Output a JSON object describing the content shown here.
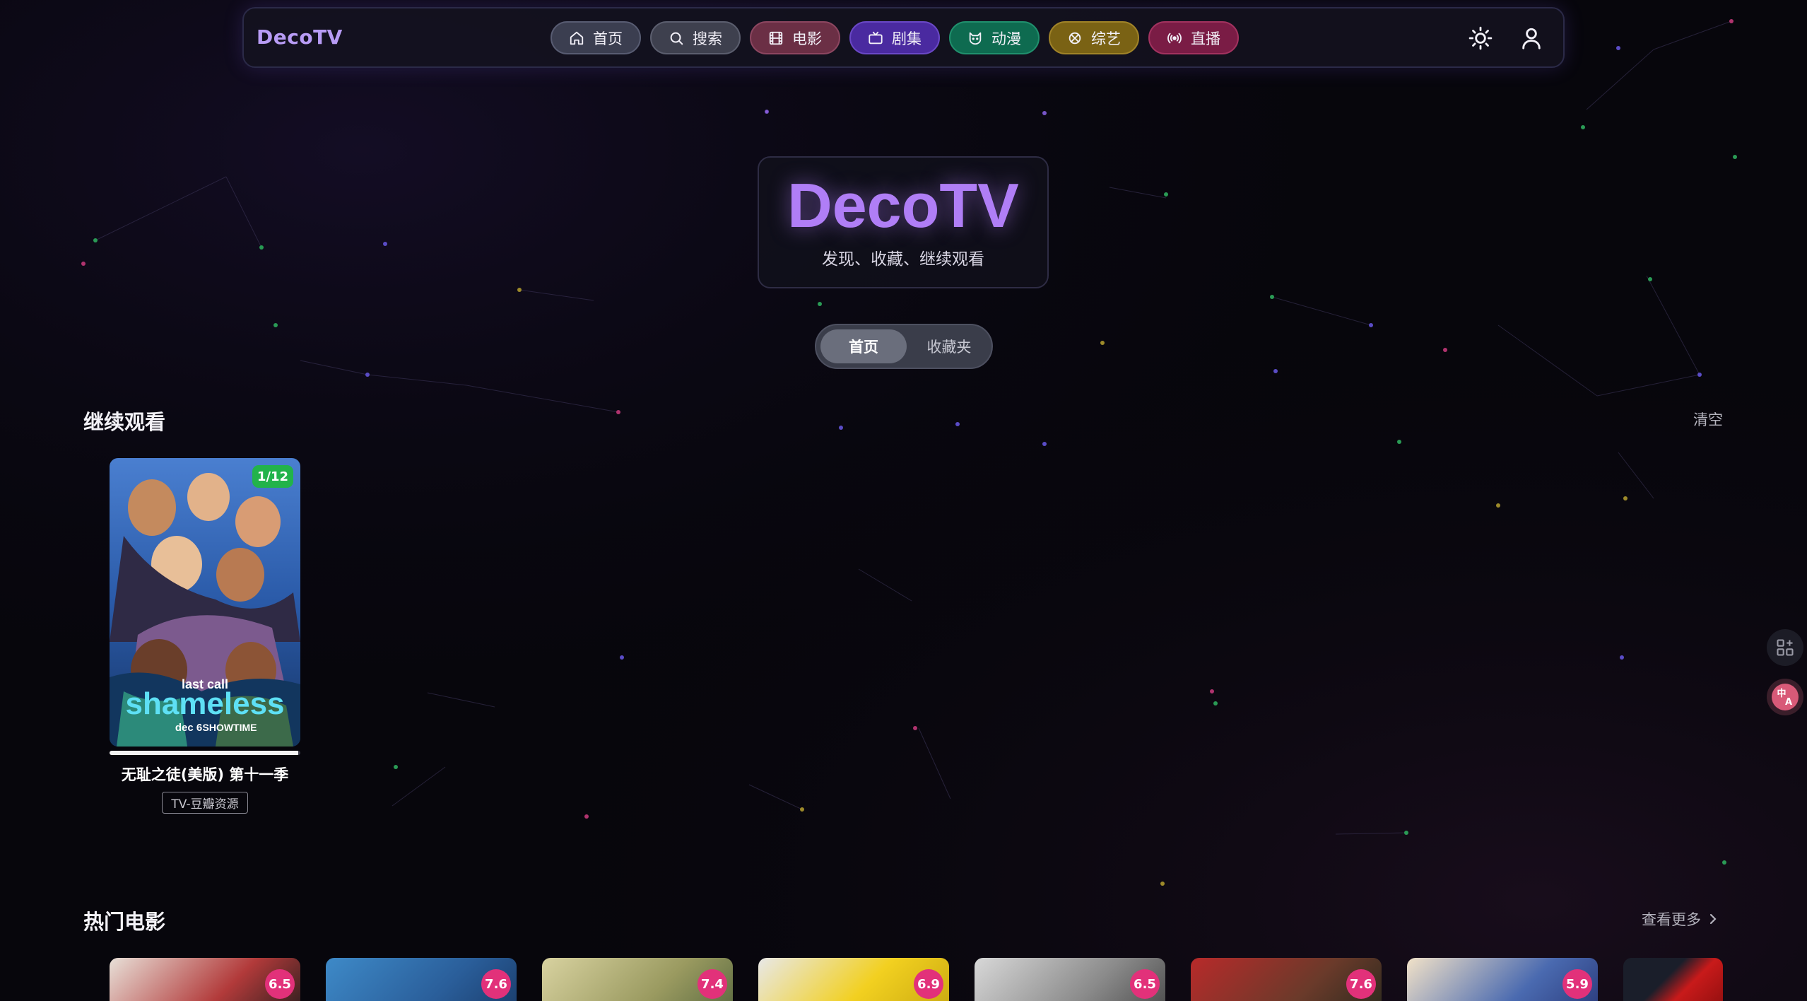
{
  "app": {
    "brand": "DecoTV"
  },
  "nav": {
    "items": [
      {
        "label": "首页",
        "icon": "home-icon"
      },
      {
        "label": "搜索",
        "icon": "search-icon"
      },
      {
        "label": "电影",
        "icon": "film-icon"
      },
      {
        "label": "剧集",
        "icon": "tv-icon"
      },
      {
        "label": "动漫",
        "icon": "cat-icon"
      },
      {
        "label": "综艺",
        "icon": "clover-icon"
      },
      {
        "label": "直播",
        "icon": "broadcast-icon"
      }
    ],
    "right_icons": [
      "sun-icon",
      "user-icon"
    ]
  },
  "hero": {
    "title": "DecoTV",
    "subtitle": "发现、收藏、继续观看"
  },
  "toggle": {
    "home": "首页",
    "favorites": "收藏夹",
    "active": "home"
  },
  "continue_watching": {
    "title": "继续观看",
    "action": "清空",
    "items": [
      {
        "title": "无耻之徒(美版) 第十一季",
        "source": "TV-豆瓣资源",
        "episode_badge": "1/12",
        "progress": 0.99,
        "poster_text": {
          "tagline": "last call",
          "name": "shameless",
          "date": "dec 6",
          "network": "SHOWTIME"
        }
      }
    ]
  },
  "hot_movies": {
    "title": "热门电影",
    "action": "查看更多",
    "items": [
      {
        "rating": "6.5"
      },
      {
        "rating": "7.6"
      },
      {
        "rating": "7.4"
      },
      {
        "rating": "6.9"
      },
      {
        "rating": "6.5"
      },
      {
        "rating": "7.6"
      },
      {
        "rating": "5.9"
      },
      {
        "rating": ""
      }
    ]
  },
  "side_buttons": [
    "grid-add-icon",
    "translate-icon"
  ],
  "colors": {
    "accent": "#b07ef6",
    "badge_green": "#22b34a",
    "rating_pink": "#e2317a"
  }
}
